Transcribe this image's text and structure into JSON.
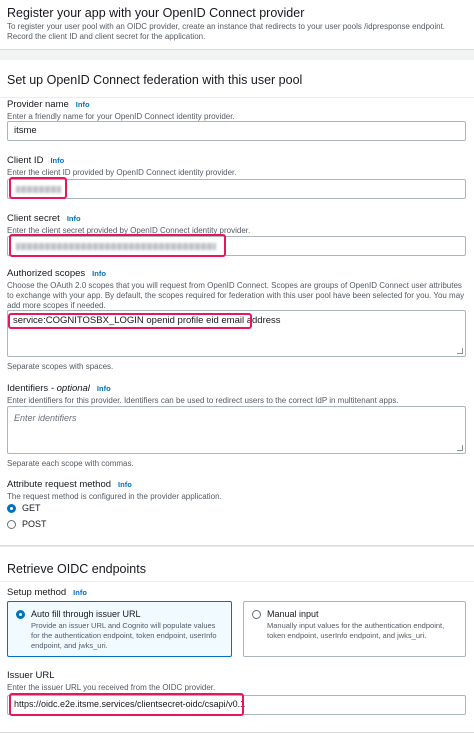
{
  "register": {
    "title": "Register your app with your OpenID Connect provider",
    "description": "To register your user pool with an OIDC provider, create an instance that redirects to your user pools /idpresponse endpoint. Record the client ID and client secret for the application."
  },
  "federation": {
    "title": "Set up OpenID Connect federation with this user pool",
    "info_label": "Info",
    "provider_name": {
      "label": "Provider name",
      "hint": "Enter a friendly name for your OpenID Connect identity provider.",
      "value": "itsme"
    },
    "client_id": {
      "label": "Client ID",
      "hint": "Enter the client ID provided by OpenID Connect identity provider."
    },
    "client_secret": {
      "label": "Client secret",
      "hint": "Enter the client secret provided by OpenID Connect identity provider."
    },
    "scopes": {
      "label": "Authorized scopes",
      "hint": "Choose the OAuth 2.0 scopes that you will request from OpenID Connect. Scopes are groups of OpenID Connect user attributes to exchange with your app. By default, the scopes required for federation with this user pool have been selected for you. You may add more scopes if needed.",
      "value": "service:COGNITOSBX_LOGIN openid profile eid email address",
      "footer": "Separate scopes with spaces."
    },
    "identifiers": {
      "label": "Identifiers",
      "optional": "- optional",
      "hint": "Enter identifiers for this provider. Identifiers can be used to redirect users to the correct IdP in multitenant apps.",
      "placeholder": "Enter identifiers",
      "footer": "Separate each scope with commas."
    },
    "attribute_method": {
      "label": "Attribute request method",
      "hint": "The request method is configured in the provider application.",
      "options": [
        "GET",
        "POST"
      ],
      "selected": "GET"
    }
  },
  "retrieve": {
    "title": "Retrieve OIDC endpoints",
    "setup_method": {
      "label": "Setup method",
      "options": [
        {
          "label": "Auto fill through issuer URL",
          "desc": "Provide an issuer URL and Cognito will populate values for the authentication endpoint, token endpoint, userInfo endpoint, and jwks_uri.",
          "selected": true
        },
        {
          "label": "Manual input",
          "desc": "Manually input values for the authentication endpoint, token endpoint, userInfo endpoint, and jwks_uri.",
          "selected": false
        }
      ]
    },
    "issuer_url": {
      "label": "Issuer URL",
      "hint": "Enter the issuer URL you received from the OIDC provider.",
      "value": "https://oidc.e2e.itsme.services/clientsecret-oidc/csapi/v0.1"
    }
  },
  "colors": {
    "accent": "#0073bb",
    "highlight": "#e8175d"
  }
}
